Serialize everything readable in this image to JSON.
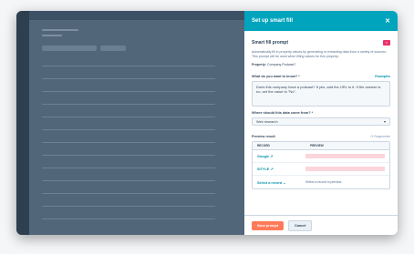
{
  "panel": {
    "title": "Set up smart fill",
    "close_icon": "close-icon"
  },
  "card": {
    "title": "Smart fill prompt",
    "badge_color": "#e8336b",
    "description": "Automatically fill in property values by generating or extracting data from a variety of sources. This prompt will be used when filling values for this property.",
    "property_key": "Property:",
    "property_value": "Company Podcast?"
  },
  "question": {
    "label": "What do you want to know? *",
    "examples_link": "Examples",
    "value": "Does this company have a podcast? If yes, add the URL to it. If the answer is no, set the value to \"No\"."
  },
  "source": {
    "label": "Where should this data come from? *",
    "selected": "Web research"
  },
  "preview": {
    "label": "Preview result",
    "regenerate": "⟳ Regenerate",
    "columns": [
      "RECORD",
      "PREVIEW"
    ],
    "rows": [
      {
        "record": "Google ↗",
        "preview": "",
        "loading": true
      },
      {
        "record": "SITYLE ↗",
        "preview": "",
        "loading": true
      },
      {
        "record": "Select a record ⌄",
        "preview": "Select a record to preview",
        "loading": false
      }
    ]
  },
  "footer": {
    "save_label": "Save prompt",
    "cancel_label": "Cancel"
  },
  "colors": {
    "header": "#00a4bd",
    "primary_button": "#ff7a59",
    "link": "#0091ae"
  }
}
